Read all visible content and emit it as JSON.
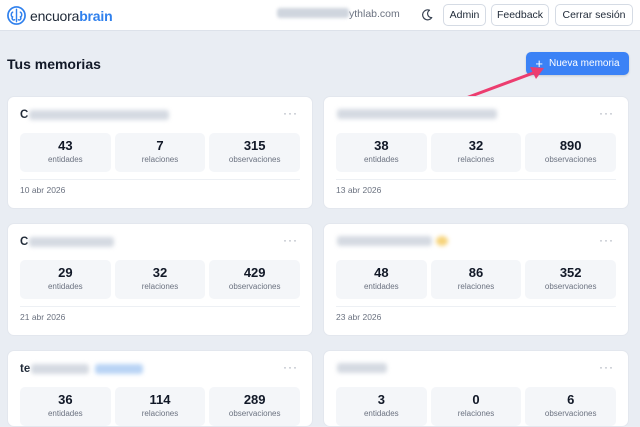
{
  "header": {
    "logo_prefix": "encuora",
    "logo_suffix": "brain",
    "email_visible": "ythlab.com",
    "admin_label": "Admin",
    "feedback_label": "Feedback",
    "logout_label": "Cerrar sesión"
  },
  "main": {
    "title": "Tus memorias",
    "new_button_label": "Nueva memoria"
  },
  "stat_labels": {
    "entities": "entidades",
    "relations": "relaciones",
    "observations": "observaciones"
  },
  "cards": [
    {
      "title_initial": "C",
      "entities": "43",
      "relations": "7",
      "observations": "315",
      "date": "10 abr 2026"
    },
    {
      "title_initial": "",
      "entities": "38",
      "relations": "32",
      "observations": "890",
      "date": "13 abr 2026"
    },
    {
      "title_initial": "C",
      "entities": "29",
      "relations": "32",
      "observations": "429",
      "date": "21 abr 2026"
    },
    {
      "title_initial": "",
      "entities": "48",
      "relations": "86",
      "observations": "352",
      "date": "23 abr 2026"
    },
    {
      "title_initial": "te",
      "entities": "36",
      "relations": "114",
      "observations": "289",
      "date": ""
    },
    {
      "title_initial": "",
      "entities": "3",
      "relations": "0",
      "observations": "6",
      "date": ""
    }
  ],
  "colors": {
    "accent": "#3b82f6",
    "annotation_arrow": "#ec3d6f",
    "background": "#e9edf3"
  },
  "icons": {
    "logo": "brain-icon",
    "theme": "moon-icon",
    "more": "more-dots-icon",
    "add": "plus-icon"
  }
}
